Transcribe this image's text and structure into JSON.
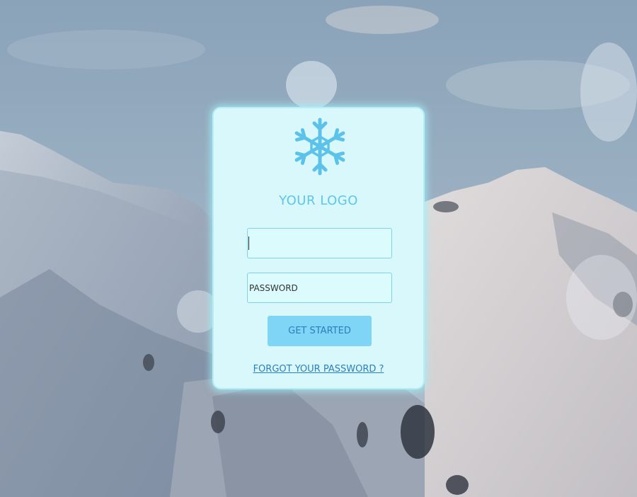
{
  "login": {
    "logo_text": "YOUR LOGO",
    "username_value": "",
    "password_placeholder": "PASSWORD",
    "submit_label": "GET STARTED",
    "forgot_link": "FORGOT YOUR PASSWORD ?"
  },
  "colors": {
    "card_background": "#d8f8fb",
    "accent": "#5fc6e8",
    "button_background": "#7fd5f5",
    "button_text": "#2a7fbf"
  },
  "icons": {
    "logo": "snowflake-icon"
  }
}
